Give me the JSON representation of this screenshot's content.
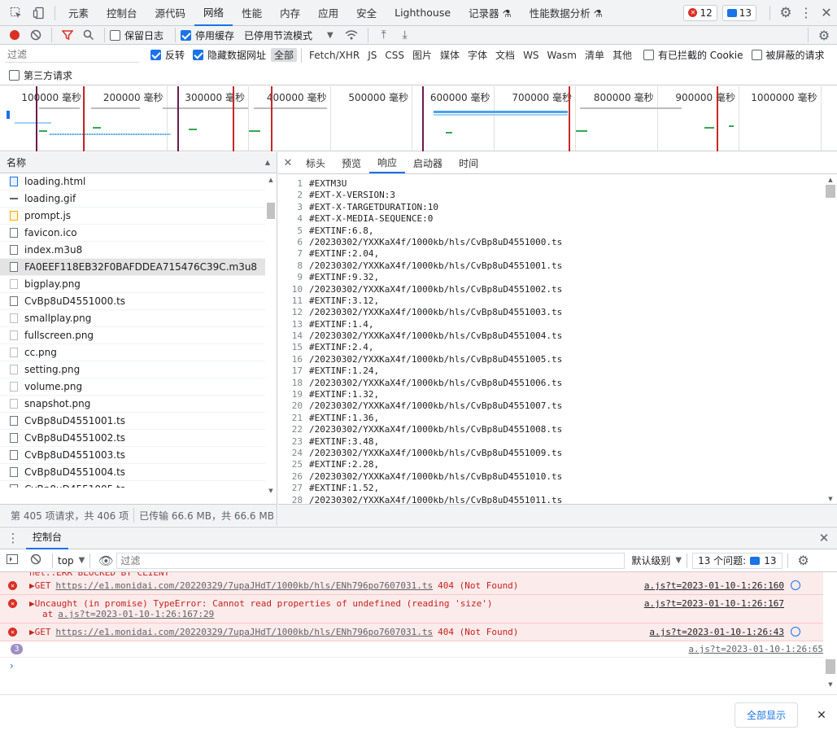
{
  "devtools_tabs": [
    "元素",
    "控制台",
    "源代码",
    "网络",
    "性能",
    "内存",
    "应用",
    "安全",
    "Lighthouse",
    "记录器 ⚗",
    "性能数据分析 ⚗"
  ],
  "badges": {
    "errors": "12",
    "issues": "13"
  },
  "network_toolbar": {
    "preserve_log": "保留日志",
    "disable_cache": "停用缓存",
    "throttle": "已停用节流模式"
  },
  "filter": {
    "placeholder": "过滤",
    "invert": "反转",
    "hide_data_urls": "隐藏数据网址",
    "types": [
      "全部",
      "Fetch/XHR",
      "JS",
      "CSS",
      "图片",
      "媒体",
      "字体",
      "文档",
      "WS",
      "Wasm",
      "清单",
      "其他"
    ],
    "blocked_cookies": "有已拦截的 Cookie",
    "blocked_requests": "被屏蔽的请求",
    "third_party": "第三方请求"
  },
  "timeline_ticks": [
    "100000 毫秒",
    "200000 毫秒",
    "300000 毫秒",
    "400000 毫秒",
    "500000 毫秒",
    "600000 毫秒",
    "700000 毫秒",
    "800000 毫秒",
    "900000 毫秒",
    "1000000 毫秒"
  ],
  "request_list": {
    "header": "名称",
    "items": [
      "loading.html",
      "loading.gif",
      "prompt.js",
      "favicon.ico",
      "index.m3u8",
      "FA0EEF118EB32F0BAFDDEA715476C39C.m3u8",
      "bigplay.png",
      "CvBp8uD4551000.ts",
      "smallplay.png",
      "fullscreen.png",
      "cc.png",
      "setting.png",
      "volume.png",
      "snapshot.png",
      "CvBp8uD4551001.ts",
      "CvBp8uD4551002.ts",
      "CvBp8uD4551003.ts",
      "CvBp8uD4551004.ts",
      "CvBp8uD4551005.ts"
    ],
    "selected": "FA0EEF118EB32F0BAFDDEA715476C39C.m3u8",
    "status": "第 405 项请求，共 406 项",
    "transferred": "已传输 66.6 MB，共 66.6 MB"
  },
  "response_tabs": [
    "标头",
    "预览",
    "响应",
    "启动器",
    "时间"
  ],
  "response_active": "响应",
  "response_lines": [
    "#EXTM3U",
    "#EXT-X-VERSION:3",
    "#EXT-X-TARGETDURATION:10",
    "#EXT-X-MEDIA-SEQUENCE:0",
    "#EXTINF:6.8,",
    "/20230302/YXXKaX4f/1000kb/hls/CvBp8uD4551000.ts",
    "#EXTINF:2.04,",
    "/20230302/YXXKaX4f/1000kb/hls/CvBp8uD4551001.ts",
    "#EXTINF:9.32,",
    "/20230302/YXXKaX4f/1000kb/hls/CvBp8uD4551002.ts",
    "#EXTINF:3.12,",
    "/20230302/YXXKaX4f/1000kb/hls/CvBp8uD4551003.ts",
    "#EXTINF:1.4,",
    "/20230302/YXXKaX4f/1000kb/hls/CvBp8uD4551004.ts",
    "#EXTINF:2.4,",
    "/20230302/YXXKaX4f/1000kb/hls/CvBp8uD4551005.ts",
    "#EXTINF:1.24,",
    "/20230302/YXXKaX4f/1000kb/hls/CvBp8uD4551006.ts",
    "#EXTINF:1.32,",
    "/20230302/YXXKaX4f/1000kb/hls/CvBp8uD4551007.ts",
    "#EXTINF:1.36,",
    "/20230302/YXXKaX4f/1000kb/hls/CvBp8uD4551008.ts",
    "#EXTINF:3.48,",
    "/20230302/YXXKaX4f/1000kb/hls/CvBp8uD4551009.ts",
    "#EXTINF:2.28,",
    "/20230302/YXXKaX4f/1000kb/hls/CvBp8uD4551010.ts",
    "#EXTINF:1.52,",
    "/20230302/YXXKaX4f/1000kb/hls/CvBp8uD4551011.ts"
  ],
  "console_drawer": {
    "tab": "控制台",
    "context": "top",
    "filter_placeholder": "过滤",
    "level": "默认级别",
    "issues_label": "13 个问题:",
    "issues_count": "13",
    "clipped_line": "net::ERR_BLOCKED_BY_CLIENT",
    "messages": [
      {
        "text": "▶GET",
        "url": "https://e1.monidai.com/20220329/7upaJHdT/1000kb/hls/ENh796po7607031.ts",
        "status": "404 (Not Found)",
        "source": "a.js?t=2023-01-10-1:26:160"
      },
      {
        "text": "▶Uncaught (in promise) TypeError: Cannot read properties of undefined (reading 'size')",
        "at": "at",
        "at_link": "a.js?t=2023-01-10-1:26:167:29",
        "source": "a.js?t=2023-01-10-1:26:167"
      },
      {
        "text": "▶GET",
        "url": "https://e1.monidai.com/20220329/7upaJHdT/1000kb/hls/ENh796po7607031.ts",
        "status": "404 (Not Found)",
        "source": "a.js?t=2023-01-10-1:26:43"
      }
    ],
    "repeat_count": "3",
    "repeat_source": "a.js?t=2023-01-10-1:26:65",
    "show_all": "全部显示"
  }
}
